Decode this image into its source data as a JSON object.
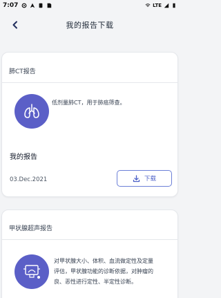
{
  "status_bar": {
    "time": "7:07",
    "network": "LTE",
    "icons": [
      "settings-icon",
      "nav-icon",
      "notification-icon",
      "sim-icon",
      "wifi-icon",
      "signal-icon",
      "battery-icon"
    ]
  },
  "header": {
    "title": "我的报告下载",
    "back_icon": "chevron-left-icon"
  },
  "cards": [
    {
      "title": "肺CT报告",
      "icon": "lungs-icon",
      "description": "低剂量肺CT，用于肺癌筛查。",
      "my_report_label": "我的报告",
      "date": "03.Dec.2021",
      "download_label": "下载",
      "download_icon": "download-icon"
    },
    {
      "title": "甲状腺超声报告",
      "icon": "ultrasound-icon",
      "description_lines": [
        "对甲状腺大小、体积、血流做定性及定量",
        "评估，甲状腺功能的诊断依据，对肿瘤的",
        "良、恶性进行定性、半定性诊断。"
      ]
    }
  ],
  "colors": {
    "accent": "#5b5fc7",
    "background": "#f3f4f6",
    "card": "#ffffff"
  }
}
